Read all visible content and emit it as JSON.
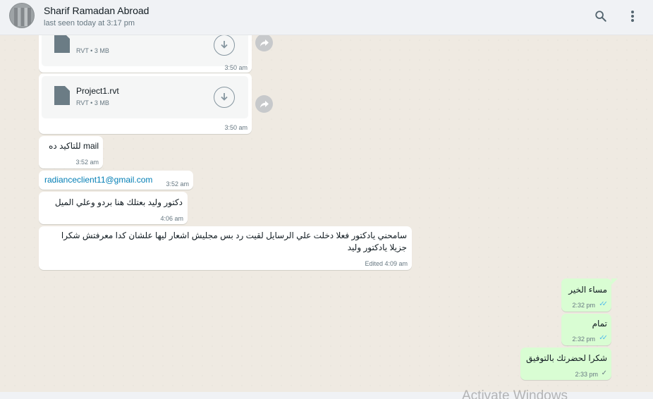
{
  "header": {
    "contact_name": "Sharif Ramadan Abroad",
    "last_seen": "last seen today at 3:17 pm",
    "search_icon": "search-icon",
    "menu_icon": "more-vertical-icon"
  },
  "messages": [
    {
      "type": "file",
      "direction": "in",
      "file_name": "",
      "file_meta": "RVT • 3 MB",
      "time": "3:50 am"
    },
    {
      "type": "file",
      "direction": "in",
      "file_name": "Project1.rvt",
      "file_meta": "RVT • 3 MB",
      "time": "3:50 am"
    },
    {
      "type": "text",
      "direction": "in",
      "text": "mail للتاكيد ده",
      "time": "3:52 am"
    },
    {
      "type": "link",
      "direction": "in",
      "text": "radianceclient11@gmail.com",
      "time": "3:52 am"
    },
    {
      "type": "text",
      "direction": "in",
      "text": "دكتور وليد بعتلك هنا بردو وعلي الميل",
      "time": "4:06 am"
    },
    {
      "type": "text",
      "direction": "in",
      "text": "سامحني يادكتور فعلا دخلت علي الرسايل لقيت رد بس مجليش اشعار ليها علشان كدا معرفتش شكرا جزيلا يادكتور وليد",
      "time": "Edited 4:09 am"
    },
    {
      "type": "text",
      "direction": "out",
      "text": "مساء الخير",
      "time": "2:32 pm",
      "status": "read"
    },
    {
      "type": "text",
      "direction": "out",
      "text": "تمام",
      "time": "2:32 pm",
      "status": "read"
    },
    {
      "type": "text",
      "direction": "out",
      "text": "شكرا لحضرتك بالتوفيق",
      "time": "2:33 pm",
      "status": "sent"
    }
  ],
  "colors": {
    "incoming_bubble": "#ffffff",
    "outgoing_bubble": "#d9fdd3",
    "read_tick": "#53bdeb",
    "link": "#027eb5"
  },
  "watermark": "Activate Windows"
}
